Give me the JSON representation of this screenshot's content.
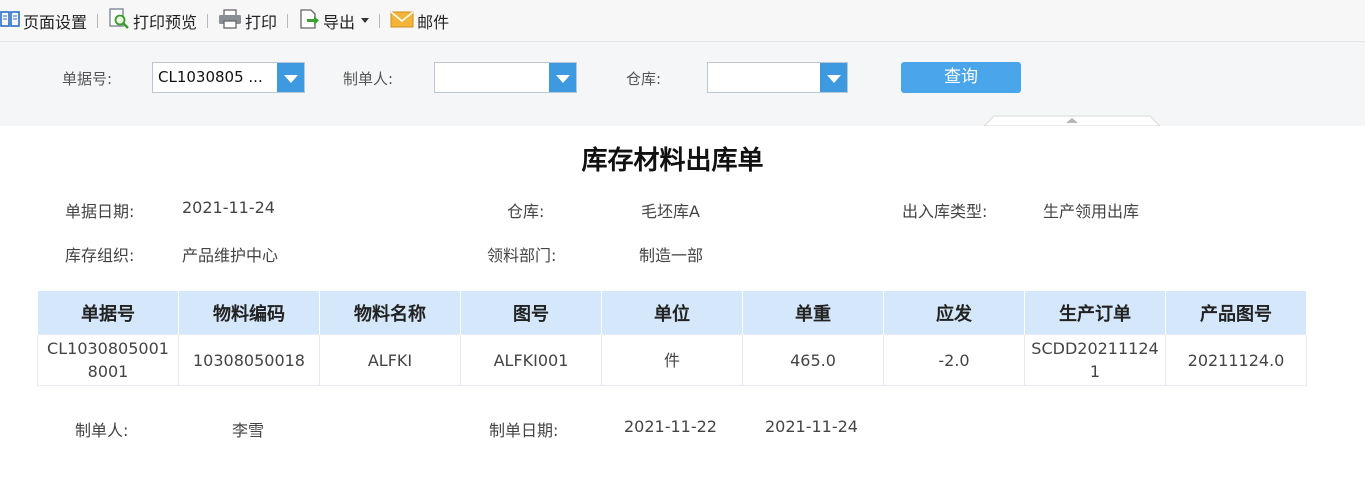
{
  "toolbar": {
    "page_setup": "页面设置",
    "print_preview": "打印预览",
    "print": "打印",
    "export": "导出",
    "mail": "邮件"
  },
  "filters": {
    "doc_no_label": "单据号:",
    "doc_no_value": "CL1030805  ...",
    "creator_label": "制单人:",
    "creator_value": "",
    "warehouse_label": "仓库:",
    "warehouse_value": "",
    "query_label": "查询"
  },
  "doc": {
    "title": "库存材料出库单",
    "date_label": "单据日期:",
    "date_value": "2021-11-24",
    "warehouse_label": "仓库:",
    "warehouse_value": "毛坯库A",
    "io_type_label": "出入库类型:",
    "io_type_value": "生产领用出库",
    "org_label": "库存组织:",
    "org_value": "产品维护中心",
    "dept_label": "领料部门:",
    "dept_value": "制造一部"
  },
  "table": {
    "headers": [
      "单据号",
      "物料编码",
      "物料名称",
      "图号",
      "单位",
      "单重",
      "应发",
      "生产订单",
      "产品图号"
    ],
    "rows": [
      [
        "CL10308050018001",
        "10308050018",
        "ALFKI",
        "ALFKI001",
        "件",
        "465.0",
        "-2.0",
        "SCDD202111241",
        "20211124.0"
      ]
    ]
  },
  "footer": {
    "creator_label": "制单人:",
    "creator_value": "李雪",
    "create_date_label": "制单日期:",
    "create_date_value": "2021-11-22",
    "extra_date_value": "2021-11-24"
  },
  "colors": {
    "accent": "#4aa5ea",
    "header_bg": "#d5e8fb"
  },
  "icons": [
    "page-setup-icon",
    "print-preview-icon",
    "printer-icon",
    "export-icon",
    "mail-icon",
    "dropdown-arrow-icon"
  ]
}
